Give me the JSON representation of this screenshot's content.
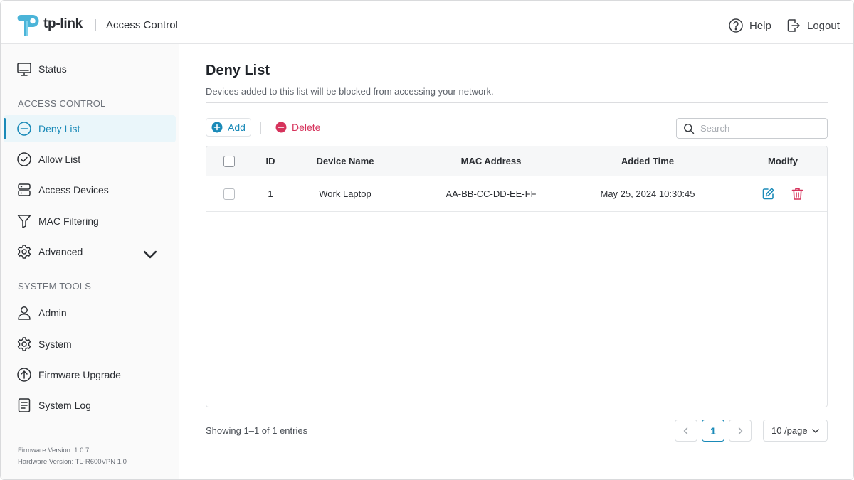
{
  "header": {
    "logo_text": "tp-link",
    "app_title": "Access Control",
    "help_label": "Help",
    "logout_label": "Logout"
  },
  "sidebar": {
    "status_label": "Status",
    "section_access": "ACCESS CONTROL",
    "section_tools": "SYSTEM TOOLS",
    "items": [
      {
        "label": "Deny List",
        "icon": "deny-list-icon",
        "active": true
      },
      {
        "label": "Allow List",
        "icon": "allow-list-icon"
      },
      {
        "label": "Access Devices",
        "icon": "access-devices-icon"
      },
      {
        "label": "MAC Filtering",
        "icon": "filter-icon"
      },
      {
        "label": "Advanced",
        "icon": "advanced-gear-icon"
      }
    ],
    "tools": [
      {
        "label": "Admin",
        "icon": "admin-icon"
      },
      {
        "label": "System",
        "icon": "system-gear-icon"
      },
      {
        "label": "Firmware Upgrade",
        "icon": "upgrade-icon"
      },
      {
        "label": "System Log",
        "icon": "log-icon"
      }
    ],
    "firmware_version": "Firmware Version:  1.0.7",
    "hardware_version": "Hardware Version:  TL-R600VPN  1.0"
  },
  "main": {
    "title": "Deny List",
    "description": "Devices added to this list will be blocked from accessing your network.",
    "add_label": "Add",
    "delete_label": "Delete",
    "search_placeholder": "Search",
    "columns": [
      "ID",
      "Device Name",
      "MAC Address",
      "Added Time",
      "Modify"
    ],
    "rows": [
      {
        "id": "1",
        "device_name": "Work Laptop",
        "mac": "AA-BB-CC-DD-EE-FF",
        "added_time": "May 25, 2024 10:30:45"
      }
    ],
    "entries_text": "Showing 1–1 of 1 entries",
    "current_page": "1",
    "per_page": "10 /page"
  },
  "colors": {
    "accent": "#1a8ab8",
    "delete": "#d6335c",
    "logo": "#4bb4d8"
  }
}
